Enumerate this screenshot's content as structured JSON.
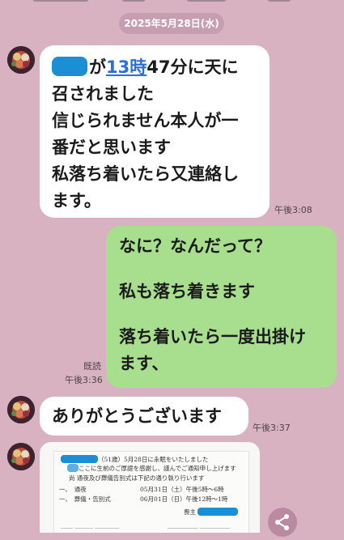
{
  "chat": {
    "date": "2025年5月28日(水)",
    "messages": [
      {
        "line1_suffix": "が",
        "line1_link": "13時",
        "line1_rest": "47分に天に",
        "line2": "召されました",
        "line3": "信じられません本人が一",
        "line4": "番だと思います",
        "line5": "私落ち着いたら又連絡し",
        "line6": "ます。",
        "time": "午後3:08"
      },
      {
        "line1": "なに？なんだって？",
        "line2": "私も落ち着きます",
        "line3": "落ち着いたら一度出掛け",
        "line4": "ます、",
        "read": "既読",
        "time": "午後3:36"
      },
      {
        "text": "ありがとうございます",
        "time": "午後3:37"
      }
    ],
    "notice": {
      "line1_age": "（51歳）5月28日に永眠をいたしました",
      "line2": "ここに生前のご厚誼を感謝し、謹んでご通知申し上げます",
      "line3": "尚 通夜及び葬儀告別式は下記の通り執り行います",
      "item1_label": "一、　通夜",
      "item1_value": "05月31日（土）午後5時～6時",
      "item2_label": "一、　葬儀・告別式",
      "item2_value": "06月01日（日）午後12時～1時",
      "host": "喪主"
    }
  },
  "colors": {
    "background": "#d9b2c2",
    "incoming": "#ffffff",
    "outgoing": "#a7df8f",
    "link": "#2d6fd8",
    "redaction": "#1a8fd6"
  },
  "icons": {
    "share": "share-icon"
  }
}
